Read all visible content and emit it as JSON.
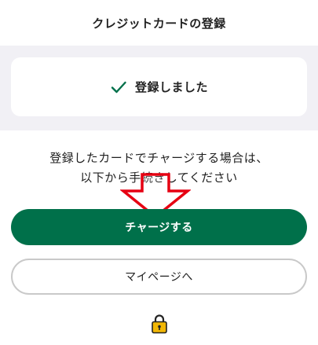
{
  "header": {
    "title": "クレジットカードの登録"
  },
  "status": {
    "icon": "check-icon",
    "text": "登録しました",
    "accent_color": "#00704a"
  },
  "message": {
    "line1": "登録したカードでチャージする場合は、",
    "line2": "以下から手続きしてください"
  },
  "overlay": {
    "icon": "down-arrow-icon",
    "color": "#e60012"
  },
  "buttons": {
    "charge_label": "チャージする",
    "charge_color": "#00704a",
    "mypage_label": "マイページへ"
  },
  "footer": {
    "icon": "lock-icon",
    "icon_color": "#f2b705"
  }
}
